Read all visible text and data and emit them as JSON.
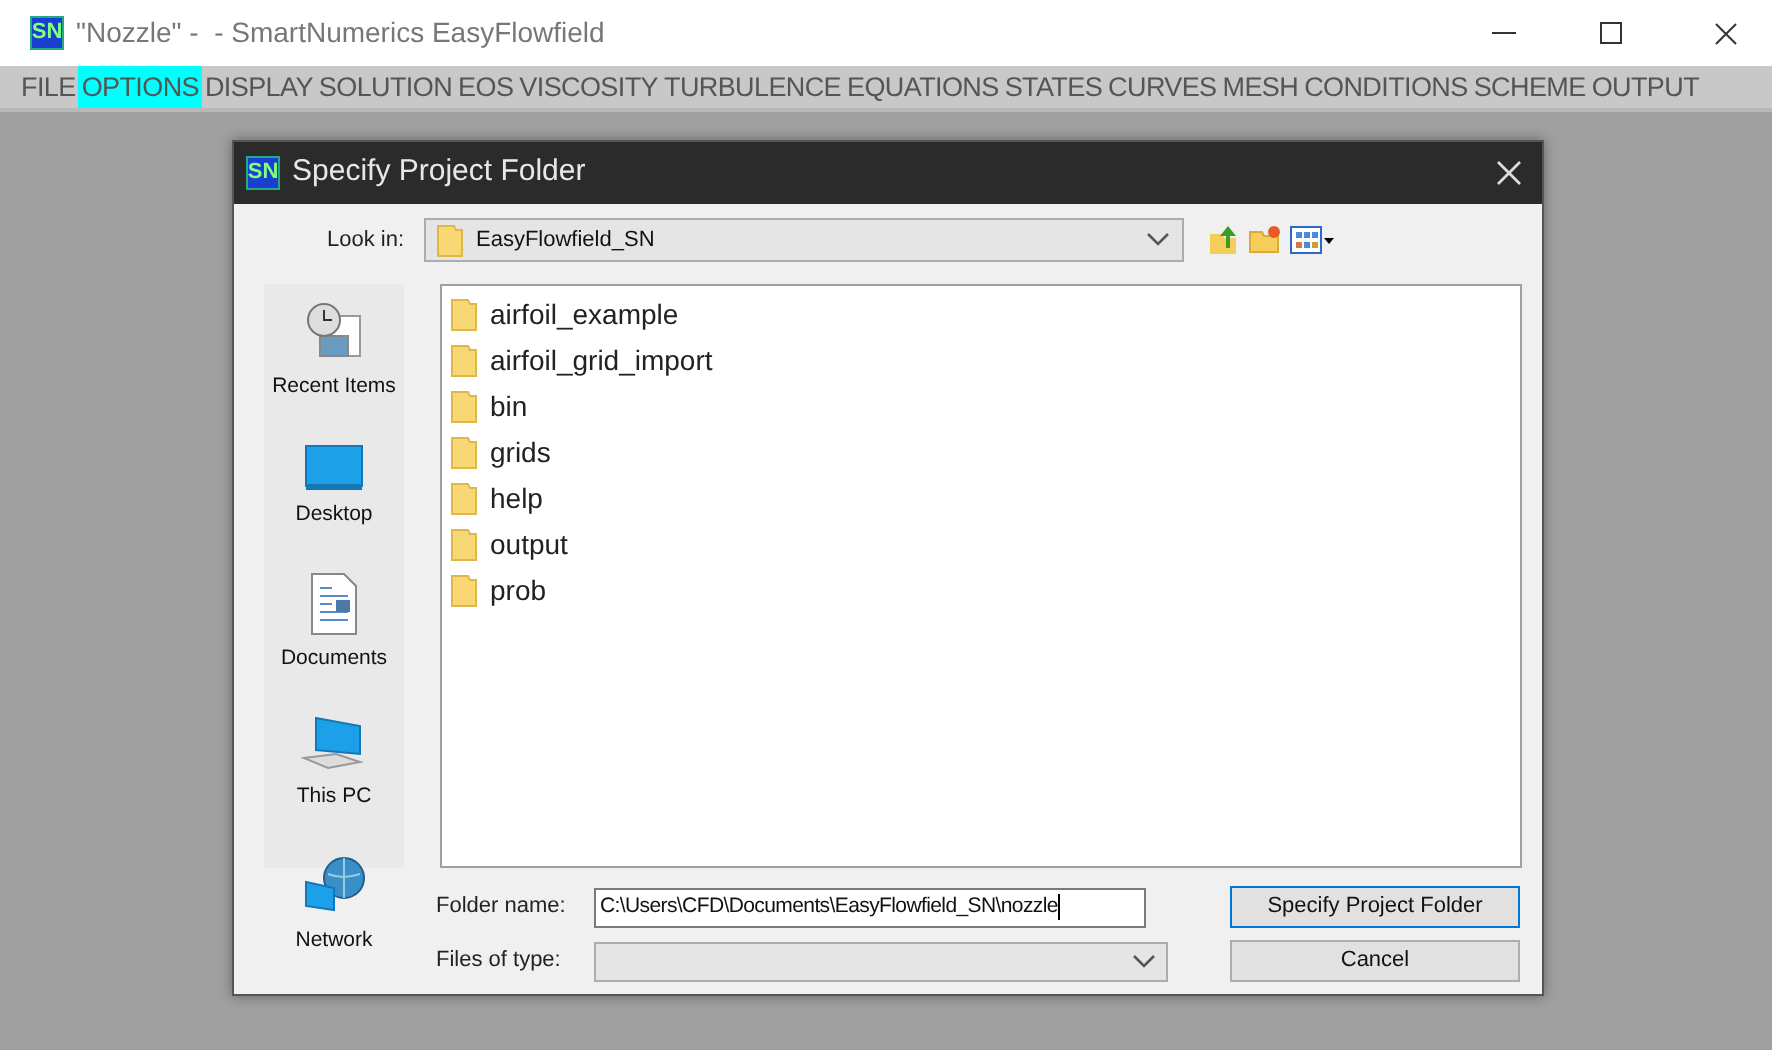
{
  "window": {
    "title": "\"Nozzle\" -  - SmartNumerics EasyFlowfield",
    "logo": "SN"
  },
  "menu": [
    {
      "label": "FILE",
      "selected": false
    },
    {
      "label": "OPTIONS",
      "selected": true
    },
    {
      "label": "DISPLAY",
      "selected": false
    },
    {
      "label": "SOLUTION",
      "selected": false
    },
    {
      "label": "EOS",
      "selected": false
    },
    {
      "label": "VISCOSITY",
      "selected": false
    },
    {
      "label": "TURBULENCE",
      "selected": false
    },
    {
      "label": "EQUATIONS",
      "selected": false
    },
    {
      "label": "STATES",
      "selected": false
    },
    {
      "label": "CURVES",
      "selected": false
    },
    {
      "label": "MESH",
      "selected": false
    },
    {
      "label": "CONDITIONS",
      "selected": false
    },
    {
      "label": "SCHEME",
      "selected": false
    },
    {
      "label": "OUTPUT",
      "selected": false
    }
  ],
  "dialog": {
    "title": "Specify Project Folder",
    "logo": "SN",
    "look_in_label": "Look in:",
    "look_in_value": "EasyFlowfield_SN",
    "places": [
      {
        "kind": "recent",
        "label": "Recent Items"
      },
      {
        "kind": "desktop",
        "label": "Desktop"
      },
      {
        "kind": "documents",
        "label": "Documents"
      },
      {
        "kind": "pc",
        "label": "This PC"
      },
      {
        "kind": "network",
        "label": "Network"
      }
    ],
    "folders": [
      "airfoil_example",
      "airfoil_grid_import",
      "bin",
      "grids",
      "help",
      "output",
      "prob"
    ],
    "folder_name_label": "Folder name:",
    "folder_name_value": "C:\\Users\\CFD\\Documents\\EasyFlowfield_SN\\nozzle",
    "files_of_type_label": "Files of type:",
    "buttons": [
      {
        "label": "Specify Project Folder",
        "selected": true
      },
      {
        "label": "Cancel",
        "selected": false
      }
    ]
  }
}
